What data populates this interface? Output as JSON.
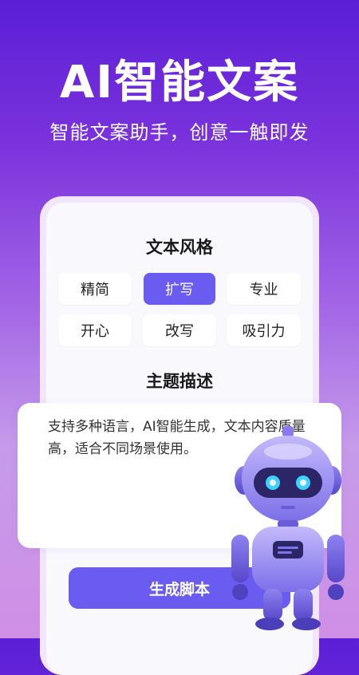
{
  "headline": "AI智能文案",
  "subheadline": "智能文案助手，创意一触即发",
  "style_section": {
    "title": "文本风格",
    "options": [
      "精简",
      "扩写",
      "专业",
      "开心",
      "改写",
      "吸引力"
    ],
    "selected": "扩写"
  },
  "topic_section": {
    "title": "主题描述",
    "description": "支持多种语言，AI智能生成，文本内容质量高，适合不同场景使用。"
  },
  "generate_button": {
    "label": "生成脚本"
  },
  "colors": {
    "accent": "#6a5cf0",
    "background_top": "#5b1fd6",
    "background_bottom": "#cf8fe6"
  },
  "illustration": "robot-mascot"
}
